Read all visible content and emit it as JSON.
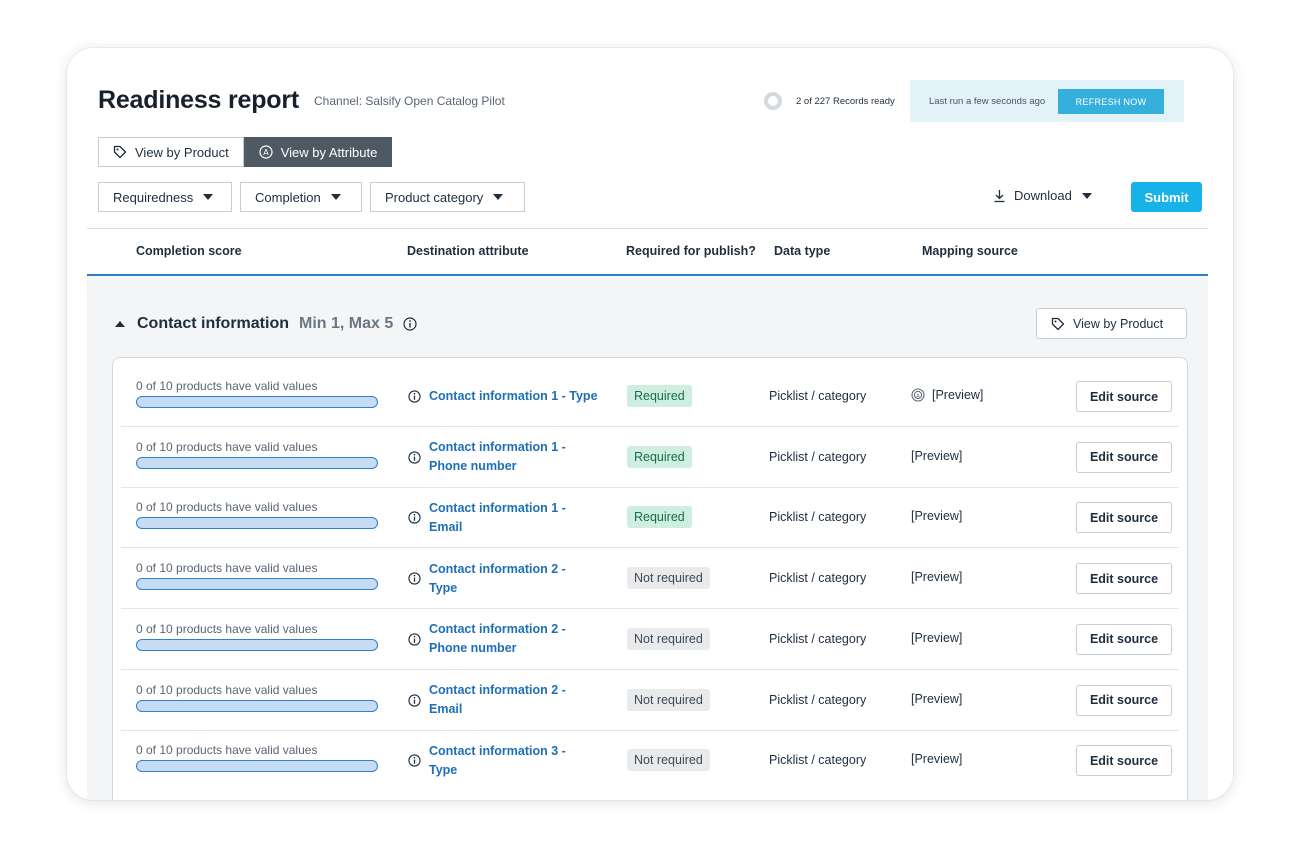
{
  "header": {
    "title": "Readiness report",
    "channel": "Channel: Salsify Open Catalog Pilot",
    "records_ready": "2 of 227 Records ready",
    "last_run": "Last run a few seconds ago",
    "refresh_label": "REFRESH NOW"
  },
  "view_toggle": {
    "by_product": "View by Product",
    "by_attribute": "View by Attribute",
    "active": "by_attribute"
  },
  "filters": {
    "requiredness": "Requiredness",
    "completion": "Completion",
    "product_category": "Product category",
    "download": "Download",
    "submit": "Submit"
  },
  "columns": {
    "completion_score": "Completion score",
    "destination_attribute": "Destination attribute",
    "required_for_publish": "Required for publish?",
    "data_type": "Data type",
    "mapping_source": "Mapping source"
  },
  "group": {
    "name": "Contact information",
    "minmax": "Min 1, Max 5",
    "view_by_product": "View by Product"
  },
  "rows": [
    {
      "score": "0 of 10 products have valid values",
      "completion": 0,
      "attr_line1": "Contact information 1 - Type",
      "attr_line2": "",
      "required": "Required",
      "type": "Picklist / category",
      "mapping": "[Preview]",
      "edit": "Edit source"
    },
    {
      "score": "0 of 10 products have valid values",
      "completion": 0,
      "attr_line1": "Contact information 1 -",
      "attr_line2": "Phone number",
      "required": "Required",
      "type": "Picklist / category",
      "mapping": "[Preview]",
      "edit": "Edit source"
    },
    {
      "score": "0 of 10 products have valid values",
      "completion": 0,
      "attr_line1": "Contact information 1 -",
      "attr_line2": "Email",
      "required": "Required",
      "type": "Picklist / category",
      "mapping": "[Preview]",
      "edit": "Edit source"
    },
    {
      "score": "0 of 10 products have valid values",
      "completion": 0,
      "attr_line1": "Contact information 2 -",
      "attr_line2": "Type",
      "required": "Not required",
      "type": "Picklist / category",
      "mapping": "[Preview]",
      "edit": "Edit source"
    },
    {
      "score": "0 of 10 products have valid values",
      "completion": 0,
      "attr_line1": "Contact information 2 -",
      "attr_line2": "Phone number",
      "required": "Not required",
      "type": "Picklist / category",
      "mapping": "[Preview]",
      "edit": "Edit source"
    },
    {
      "score": "0 of 10 products have valid values",
      "completion": 0,
      "attr_line1": "Contact information 2 -",
      "attr_line2": "Email",
      "required": "Not required",
      "type": "Picklist / category",
      "mapping": "[Preview]",
      "edit": "Edit source"
    },
    {
      "score": "0 of 10 products have valid values",
      "completion": 0,
      "attr_line1": "Contact information 3 -",
      "attr_line2": "Type",
      "required": "Not required",
      "type": "Picklist / category",
      "mapping": "[Preview]",
      "edit": "Edit source"
    }
  ],
  "colors": {
    "accent": "#17b2e8",
    "link": "#1d6fb8",
    "required_bg": "#cdeee1",
    "not_required_bg": "#e8eaec",
    "active_toggle": "#4f5964"
  },
  "icons": {
    "tag": "tag-icon",
    "attribute": "attribute-circle-icon",
    "download": "download-icon",
    "info": "info-icon",
    "mapping": "mapping-source-icon"
  }
}
